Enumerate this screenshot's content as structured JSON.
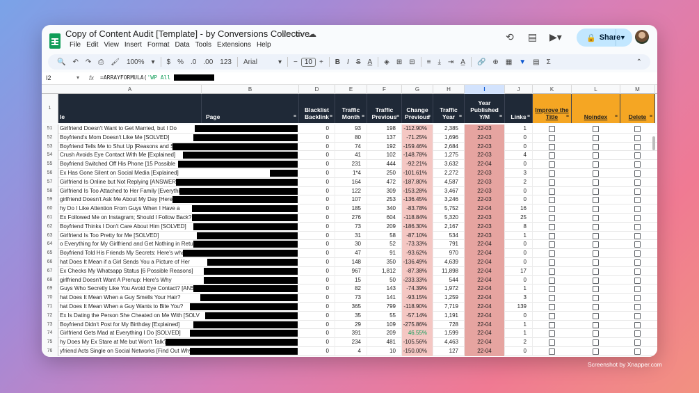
{
  "app": {
    "title": "Copy of Content Audit [Template] - by Conversions Collective",
    "menus": [
      "File",
      "Edit",
      "View",
      "Insert",
      "Format",
      "Data",
      "Tools",
      "Extensions",
      "Help"
    ],
    "share_label": "Share"
  },
  "toolbar": {
    "zoom": "100%",
    "currency": "$",
    "percent": "%",
    "dec_less": ".0",
    "dec_more": ".00",
    "format_num": "123",
    "font": "Arial",
    "font_size": "10",
    "bold": "B",
    "italic": "I",
    "strike": "S",
    "text_color": "A",
    "sum": "Σ"
  },
  "formula_bar": {
    "cell_ref": "I2",
    "fx": "fx",
    "formula_prefix": "=ARRAYFORMULA(",
    "formula_str": "'WP All"
  },
  "columns": [
    "A",
    "B",
    "D",
    "E",
    "F",
    "G",
    "H",
    "I",
    "J",
    "K",
    "L",
    "M"
  ],
  "header_row_num": "1",
  "headers": {
    "a": "le",
    "b": "Page",
    "d": "Blacklist Backlink",
    "e": "Traffic Month",
    "f": "Traffic Previous",
    "g": "Change Previous",
    "h": "Traffic Year",
    "i": "Year Published Y/M",
    "j": "Links",
    "k": "Improve the Title",
    "l": "Noindex",
    "m": "Delete"
  },
  "rows": [
    {
      "n": "51",
      "a": "Girlfriend Doesn't Want to Get Married, but I Do",
      "d": "0",
      "e": "93",
      "f": "198",
      "g": "-112.90%",
      "h": "2,385",
      "i": "22-03",
      "j": "1"
    },
    {
      "n": "52",
      "a": "Boyfriend's Mom Doesn't Like Me [SOLVED]",
      "d": "0",
      "e": "80",
      "f": "137",
      "g": "-71.25%",
      "h": "1,696",
      "i": "22-03",
      "j": "0"
    },
    {
      "n": "53",
      "a": "Boyfriend Tells Me to Shut Up [Reasons and Solution]",
      "d": "0",
      "e": "74",
      "f": "192",
      "g": "-159.46%",
      "h": "2,684",
      "i": "22-03",
      "j": "0"
    },
    {
      "n": "54",
      "a": "Crush Avoids Eye Contact With Me [Explained]",
      "d": "0",
      "e": "41",
      "f": "102",
      "g": "-148.78%",
      "h": "1,275",
      "i": "22-03",
      "j": "4"
    },
    {
      "n": "55",
      "a": "Boyfriend Switched Off His Phone [15 Possible",
      "d": "0",
      "e": "231",
      "f": "444",
      "g": "-92.21%",
      "h": "3,632",
      "i": "22-04",
      "j": "0"
    },
    {
      "n": "56",
      "a": "Ex Has Gone Silent on Social Media [Explained]",
      "d": "0",
      "e": "1*4",
      "f": "250",
      "g": "-101.61%",
      "h": "2,272",
      "i": "22-03",
      "j": "3"
    },
    {
      "n": "57",
      "a": "Girlfriend Is Online but Not Replying [ANSWERED]",
      "d": "0",
      "e": "164",
      "f": "472",
      "g": "-187.80%",
      "h": "4,587",
      "i": "22-03",
      "j": "2"
    },
    {
      "n": "58",
      "a": "Girlfriend Is Too Attached to Her Family [Everything You",
      "d": "0",
      "e": "122",
      "f": "309",
      "g": "-153.28%",
      "h": "3,467",
      "i": "22-03",
      "j": "0"
    },
    {
      "n": "59",
      "a": "girlfriend Doesn't Ask Me About My Day [Here's Why",
      "d": "0",
      "e": "107",
      "f": "253",
      "g": "-136.45%",
      "h": "3,246",
      "i": "22-03",
      "j": "0"
    },
    {
      "n": "60",
      "a": "hy Do I Like Attention From Guys When I Have a",
      "d": "0",
      "e": "185",
      "f": "340",
      "g": "-83.78%",
      "h": "5,752",
      "i": "22-04",
      "j": "16"
    },
    {
      "n": "61",
      "a": "Ex Followed Me on Instagram; Should I Follow Back?",
      "d": "0",
      "e": "276",
      "f": "604",
      "g": "-118.84%",
      "h": "5,320",
      "i": "22-03",
      "j": "25"
    },
    {
      "n": "62",
      "a": "Boyfriend Thinks I Don't Care About Him [SOLVED]",
      "d": "0",
      "e": "73",
      "f": "209",
      "g": "-186.30%",
      "h": "2,167",
      "i": "22-03",
      "j": "8"
    },
    {
      "n": "63",
      "a": "Girlfriend Is Too Pretty for Me [SOLVED]",
      "d": "0",
      "e": "31",
      "f": "58",
      "g": "-87.10%",
      "h": "534",
      "i": "22-03",
      "j": "1"
    },
    {
      "n": "64",
      "a": "o Everything for My Girlfriend and Get Nothing in Return",
      "d": "0",
      "e": "30",
      "f": "52",
      "g": "-73.33%",
      "h": "791",
      "i": "22-04",
      "j": "0"
    },
    {
      "n": "65",
      "a": "Boyfriend Told His Friends My Secrets: Here's what to",
      "d": "0",
      "e": "47",
      "f": "91",
      "g": "-93.62%",
      "h": "970",
      "i": "22-04",
      "j": "0"
    },
    {
      "n": "66",
      "a": "hat Does It Mean if a Girl Sends You a Picture of Her",
      "d": "0",
      "e": "148",
      "f": "350",
      "g": "-136.49%",
      "h": "4,639",
      "i": "22-04",
      "j": "0"
    },
    {
      "n": "67",
      "a": "Ex Checks My Whatsapp Status [6 Possible Reasons]",
      "d": "0",
      "e": "967",
      "f": "1,812",
      "g": "-87.38%",
      "h": "11,898",
      "i": "22-04",
      "j": "17"
    },
    {
      "n": "68",
      "a": "girlfriend Doesn't Want A Prenup: Here's Why",
      "d": "0",
      "e": "15",
      "f": "50",
      "g": "-233.33%",
      "h": "544",
      "i": "22-04",
      "j": "0"
    },
    {
      "n": "69",
      "a": "Guys Who Secretly Like You Avoid Eye Contact? [ANSW",
      "d": "0",
      "e": "82",
      "f": "143",
      "g": "-74.39%",
      "h": "1,972",
      "i": "22-04",
      "j": "1"
    },
    {
      "n": "70",
      "a": "hat Does It Mean When a Guy Smells Your Hair?",
      "d": "0",
      "e": "73",
      "f": "141",
      "g": "-93.15%",
      "h": "1,259",
      "i": "22-04",
      "j": "3"
    },
    {
      "n": "71",
      "a": "hat Does It Mean When a Guy Wants to Bite You?",
      "d": "0",
      "e": "365",
      "f": "799",
      "g": "-118.90%",
      "h": "7,719",
      "i": "22-04",
      "j": "139"
    },
    {
      "n": "72",
      "a": "Ex Is Dating the Person She Cheated on Me With [SOLV",
      "d": "0",
      "e": "35",
      "f": "55",
      "g": "-57.14%",
      "h": "1,191",
      "i": "22-04",
      "j": "0"
    },
    {
      "n": "73",
      "a": "Boyfriend Didn't Post for My Birthday [Explained]",
      "d": "0",
      "e": "29",
      "f": "109",
      "g": "-275.86%",
      "h": "728",
      "i": "22-04",
      "j": "1"
    },
    {
      "n": "74",
      "a": "Girlfriend Gets Mad at Everything I Do [SOLVED]",
      "d": "0",
      "e": "391",
      "f": "209",
      "g": "46.55%",
      "h": "1,599",
      "i": "22-04",
      "j": "1"
    },
    {
      "n": "75",
      "a": "hy Does My Ex Stare at Me but Won't Talk?",
      "d": "0",
      "e": "234",
      "f": "481",
      "g": "-105.56%",
      "h": "4,463",
      "i": "22-04",
      "j": "2"
    },
    {
      "n": "76",
      "a": "yfriend Acts Single on Social Networks [Find Out Why]",
      "d": "0",
      "e": "4",
      "f": "10",
      "g": "-150.00%",
      "h": "127",
      "i": "22-04",
      "j": "0"
    }
  ],
  "credit": "Screenshot by Xnapper.com"
}
